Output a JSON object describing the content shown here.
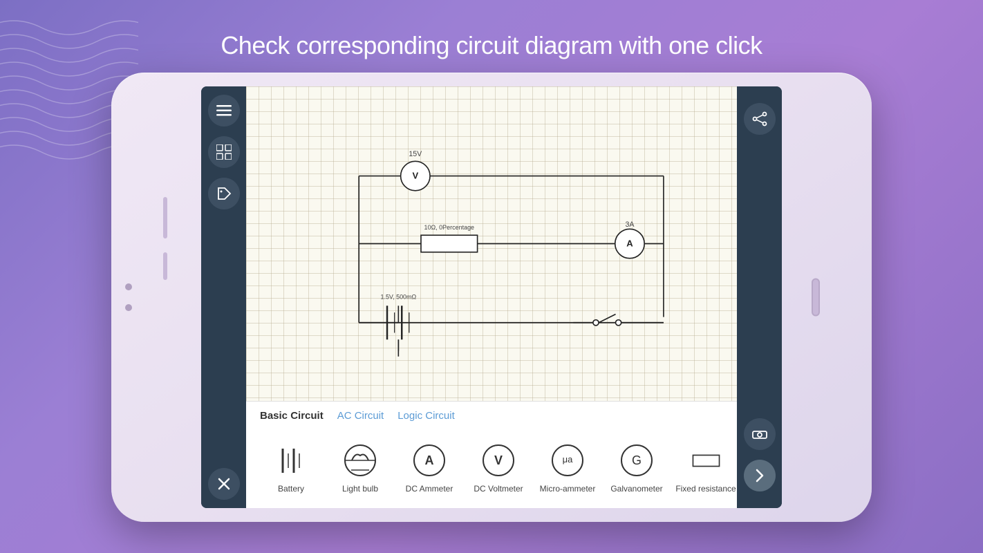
{
  "headline": "Check corresponding circuit diagram with one click",
  "tabs": [
    {
      "label": "Basic Circuit",
      "active": true,
      "type": "bold"
    },
    {
      "label": "AC Circuit",
      "active": false,
      "type": "link"
    },
    {
      "label": "Logic Circuit",
      "active": false,
      "type": "link"
    }
  ],
  "components": [
    {
      "name": "battery-item",
      "label": "Battery",
      "icon": "battery"
    },
    {
      "name": "lightbulb-item",
      "label": "Light bulb",
      "icon": "lightbulb"
    },
    {
      "name": "dc-ammeter-item",
      "label": "DC Ammeter",
      "icon": "ammeter"
    },
    {
      "name": "dc-voltmeter-item",
      "label": "DC Voltmeter",
      "icon": "voltmeter"
    },
    {
      "name": "micro-ammeter-item",
      "label": "Micro-ammeter",
      "icon": "micro-ammeter"
    },
    {
      "name": "galvanometer-item",
      "label": "Galvanometer",
      "icon": "galvanometer"
    },
    {
      "name": "fixed-resistance-item",
      "label": "Fixed resistance",
      "icon": "resistor"
    }
  ],
  "circuit": {
    "voltmeter_label": "15V",
    "ammeter_label": "3A",
    "resistor_label": "10Ω, 0Percentage",
    "battery_label": "1.5V, 500mΩ"
  },
  "sidebar_buttons": {
    "menu": "☰",
    "grid": "⊞",
    "tag": "🏷",
    "close": "✕"
  },
  "right_sidebar": {
    "share": "share",
    "eraser": "eraser",
    "next": "❯"
  }
}
